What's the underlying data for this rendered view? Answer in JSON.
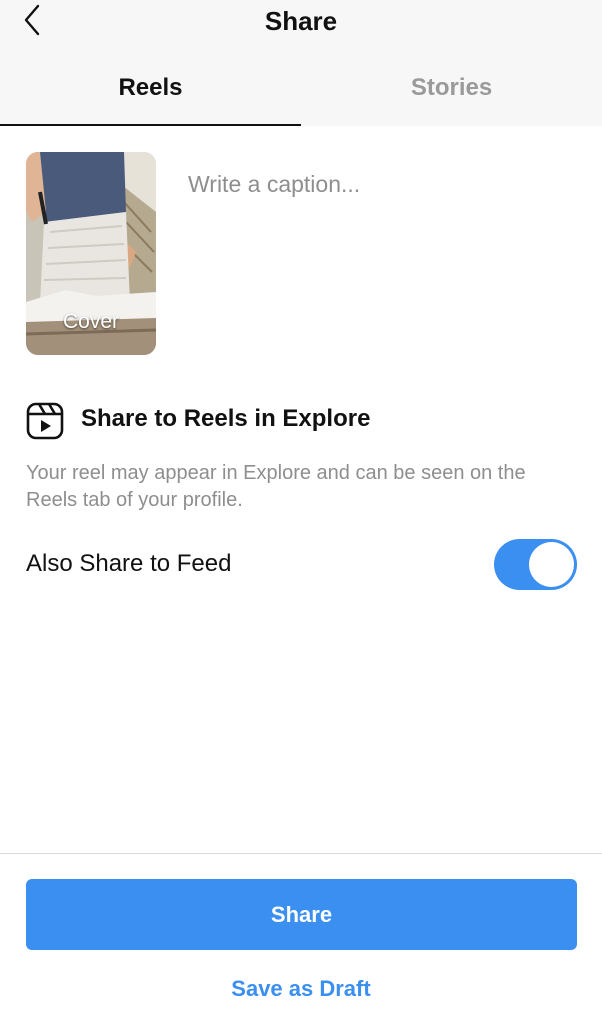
{
  "header": {
    "title": "Share",
    "back_icon": "chevron-left-icon"
  },
  "tabs": [
    {
      "label": "Reels",
      "active": true
    },
    {
      "label": "Stories",
      "active": false
    }
  ],
  "cover": {
    "label": "Cover"
  },
  "caption": {
    "placeholder": "Write a caption...",
    "value": ""
  },
  "explore": {
    "icon": "reels-icon",
    "title": "Share to Reels in Explore",
    "description": "Your reel may appear in Explore and can be seen on the Reels tab of your profile."
  },
  "feed": {
    "label": "Also Share to Feed",
    "enabled": true
  },
  "actions": {
    "share_label": "Share",
    "draft_label": "Save as Draft"
  },
  "colors": {
    "accent": "#3b8ff0",
    "secondary_text": "#8e8e8e",
    "header_bg": "#f7f7f7"
  }
}
